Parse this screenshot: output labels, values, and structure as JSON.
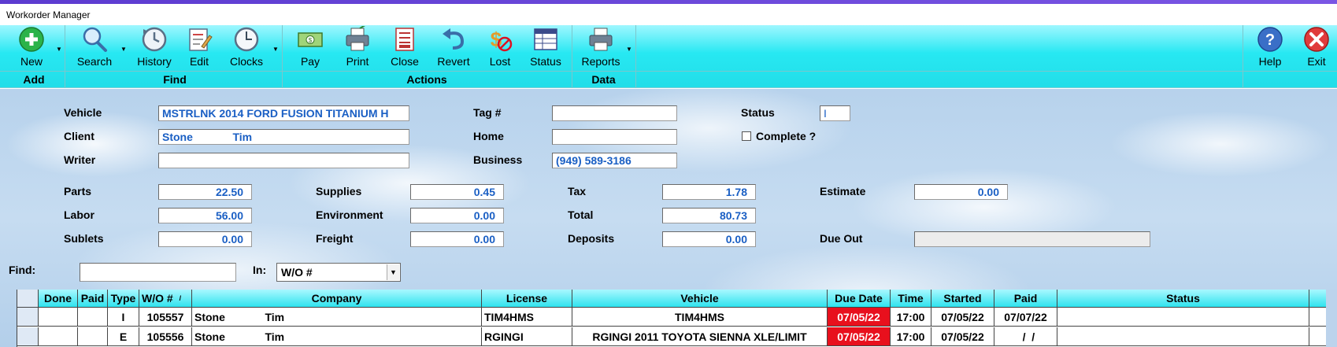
{
  "window": {
    "title": "Workorder Manager"
  },
  "ribbon": {
    "buttons": [
      {
        "label": "New"
      },
      {
        "label": "Search"
      },
      {
        "label": "History"
      },
      {
        "label": "Edit"
      },
      {
        "label": "Clocks"
      },
      {
        "label": "Pay"
      },
      {
        "label": "Print"
      },
      {
        "label": "Close"
      },
      {
        "label": "Revert"
      },
      {
        "label": "Lost"
      },
      {
        "label": "Status"
      },
      {
        "label": "Reports"
      },
      {
        "label": "Help"
      },
      {
        "label": "Exit"
      }
    ],
    "groups": [
      {
        "label": "Add"
      },
      {
        "label": "Find"
      },
      {
        "label": "Actions"
      },
      {
        "label": "Data"
      }
    ],
    "icons": [
      "plus-circle-icon",
      "magnifier-icon",
      "history-clock-icon",
      "edit-form-icon",
      "clock-icon",
      "money-icon",
      "printer-icon",
      "close-document-icon",
      "undo-arrow-icon",
      "lost-dollar-icon",
      "status-grid-icon",
      "reports-icon",
      "help-question-icon",
      "exit-x-icon"
    ]
  },
  "form": {
    "vehicle_label": "Vehicle",
    "vehicle_value": "MSTRLNK 2014 FORD FUSION TITANIUM H",
    "client_label": "Client",
    "client_value": "Stone             Tim",
    "writer_label": "Writer",
    "writer_value": "",
    "tag_label": "Tag #",
    "tag_value": "",
    "home_label": "Home",
    "home_value": "",
    "business_label": "Business",
    "business_value": "(949) 589-3186",
    "status_label": "Status",
    "status_value": "I",
    "complete_label": "Complete ?",
    "complete_checked": false,
    "parts_label": "Parts",
    "parts_value": "22.50",
    "labor_label": "Labor",
    "labor_value": "56.00",
    "sublets_label": "Sublets",
    "sublets_value": "0.00",
    "supplies_label": "Supplies",
    "supplies_value": "0.45",
    "environment_label": "Environment",
    "environment_value": "0.00",
    "freight_label": "Freight",
    "freight_value": "0.00",
    "tax_label": "Tax",
    "tax_value": "1.78",
    "total_label": "Total",
    "total_value": "80.73",
    "deposits_label": "Deposits",
    "deposits_value": "0.00",
    "estimate_label": "Estimate",
    "estimate_value": "0.00",
    "dueout_label": "Due Out",
    "dueout_value": ""
  },
  "find": {
    "label": "Find:",
    "value": "",
    "in_label": "In:",
    "in_selected": "W/O #"
  },
  "table": {
    "columns": [
      "Done",
      "Paid",
      "Type",
      "W/O #",
      "Company",
      "License",
      "Vehicle",
      "Due Date",
      "Time",
      "Started",
      "Paid",
      "Status"
    ],
    "sort_indicator": "/",
    "rows": [
      {
        "done": "",
        "paid": "",
        "type": "I",
        "wo": "105557",
        "company": "Stone             Tim",
        "license": "TIM4HMS",
        "vehicle": "TIM4HMS",
        "due_date": "07/05/22",
        "time": "17:00",
        "started": "07/05/22",
        "paid_date": "07/07/22",
        "status": ""
      },
      {
        "done": "",
        "paid": "",
        "type": "E",
        "wo": "105556",
        "company": "Stone             Tim",
        "license": "RGINGI",
        "vehicle": "RGINGI 2011 TOYOTA SIENNA XLE/LIMIT",
        "due_date": "07/05/22",
        "time": "17:00",
        "started": "07/05/22",
        "paid_date": "  /  /",
        "status": ""
      }
    ]
  },
  "colors": {
    "ribbon": "#27e8f2",
    "field_text": "#1a5fc4",
    "due_highlight": "#e8101d"
  }
}
